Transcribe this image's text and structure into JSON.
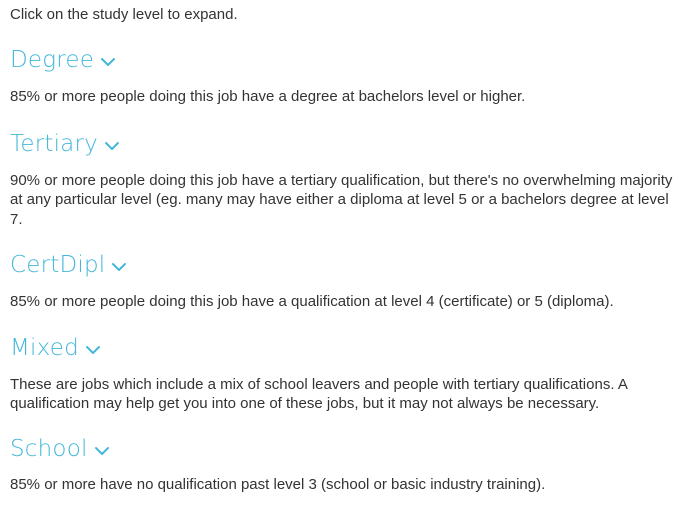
{
  "intro": "Click on the study level to expand.",
  "accent_color": "#44b7d9",
  "levels": [
    {
      "title": "Degree",
      "icon": "chevron-down-icon",
      "description": "85% or more people doing this job have a degree at bachelors level or higher."
    },
    {
      "title": "Tertiary",
      "icon": "chevron-down-icon",
      "description": "90% or more people doing this job have a tertiary qualification, but there's no overwhelming majority at any particular level (eg. many may have either a diploma at level 5 or a bachelors degree at level 7."
    },
    {
      "title": "CertDipl",
      "icon": "chevron-down-icon",
      "description": "85% or more people doing this job have a qualification at level 4 (certificate) or 5 (diploma)."
    },
    {
      "title": "Mixed",
      "icon": "chevron-down-icon",
      "description": "These are jobs which include a mix of school leavers and people with tertiary qualifications. A qualification may help get you into one of these jobs, but it may not always be necessary."
    },
    {
      "title": "School",
      "icon": "chevron-down-icon",
      "description": "85% or more have no qualification past level 3 (school or basic industry training)."
    }
  ]
}
